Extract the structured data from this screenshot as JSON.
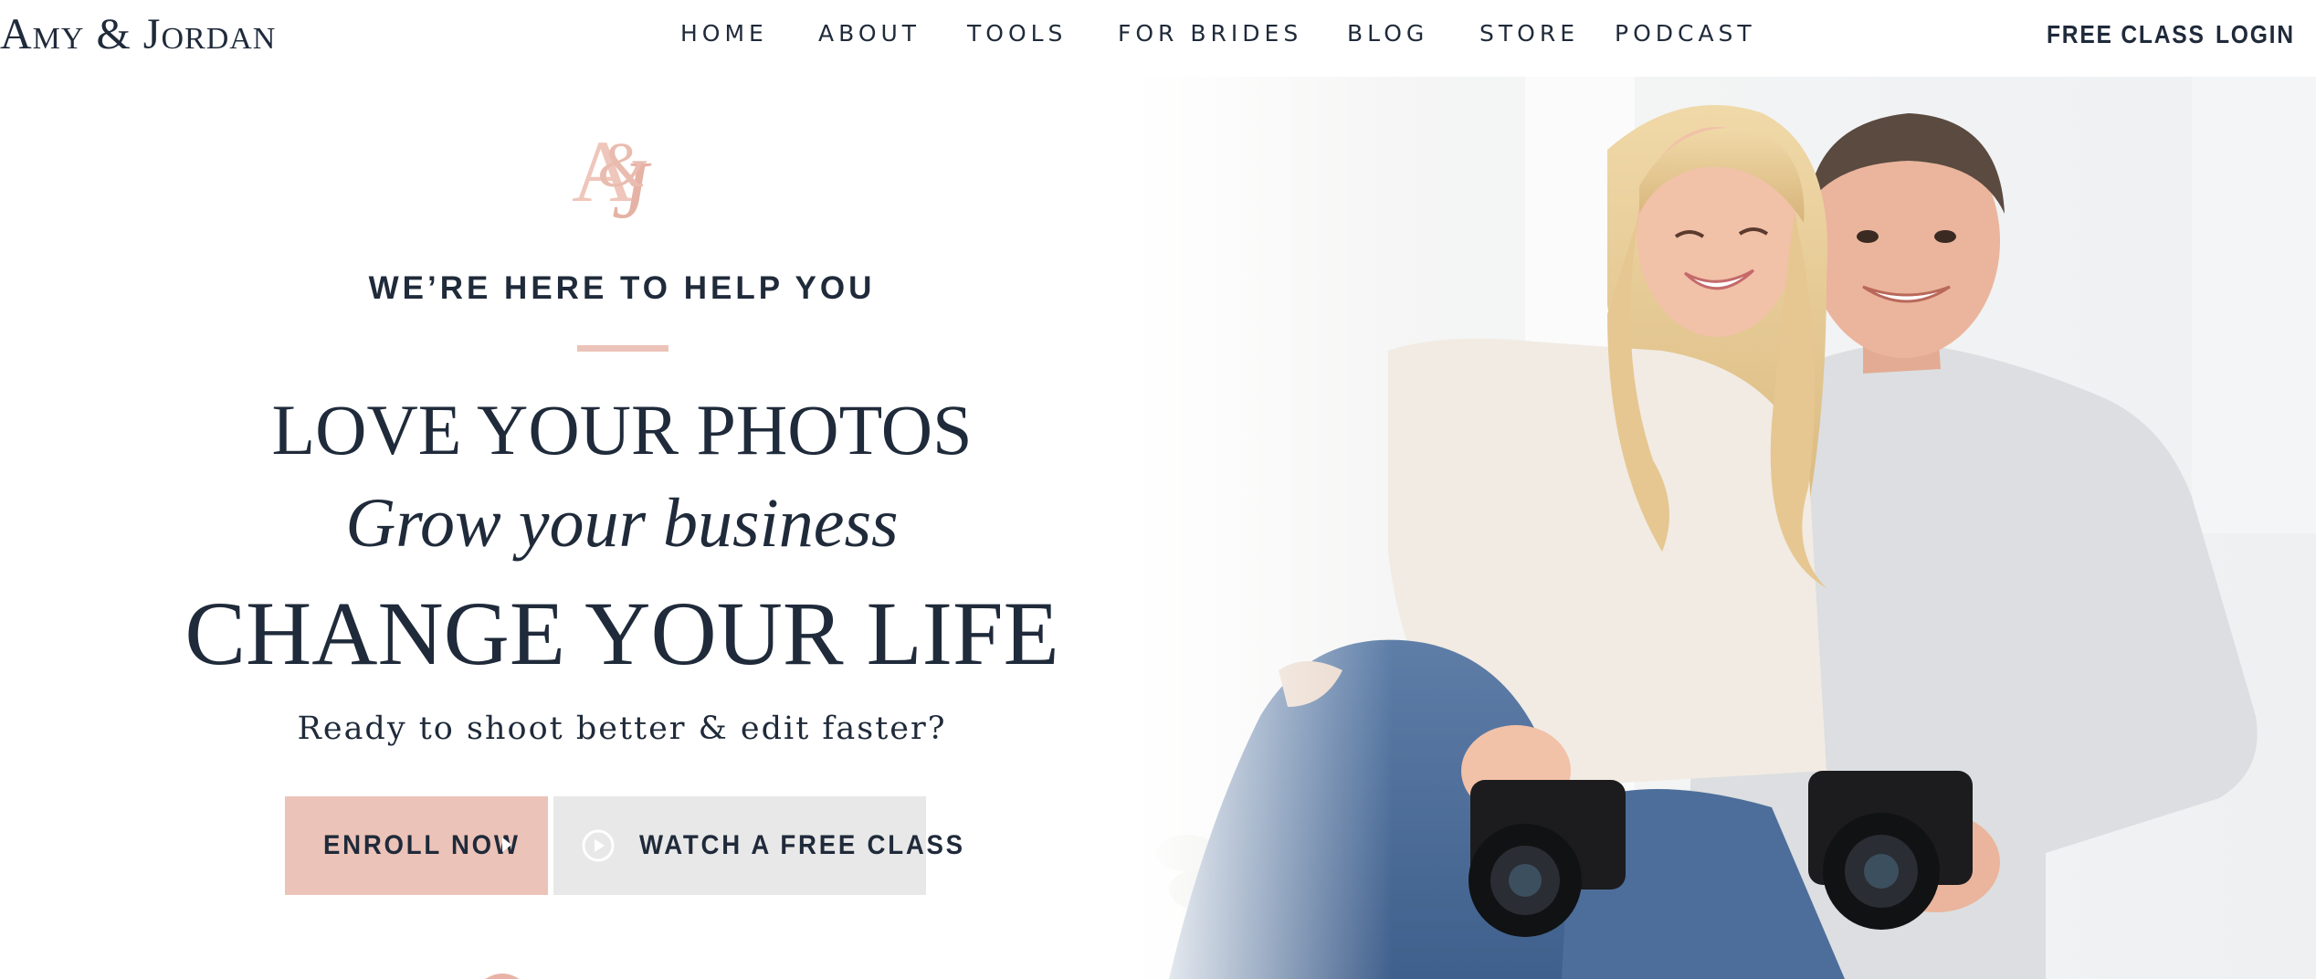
{
  "header": {
    "logo": "Amy & Jordan",
    "nav": [
      "HOME",
      "ABOUT",
      "TOOLS",
      "FOR BRIDES",
      "BLOG",
      "STORE",
      "PODCAST"
    ],
    "free_class": "FREE CLASS",
    "login": "LOGIN"
  },
  "hero": {
    "monogram": "A&J",
    "kicker": "WE’RE HERE TO HELP YOU",
    "headline_line1": "LOVE YOUR PHOTOS",
    "headline_line2": "Grow your business",
    "headline_line3": "CHANGE YOUR LIFE",
    "subtitle": "Ready to shoot better & edit faster?",
    "enroll_button": "ENROLL NOW",
    "watch_button": "WATCH A FREE CLASS"
  },
  "colors": {
    "navy": "#1f2a3a",
    "blush": "#ecc3b8",
    "light_gray": "#e8e8e8"
  }
}
